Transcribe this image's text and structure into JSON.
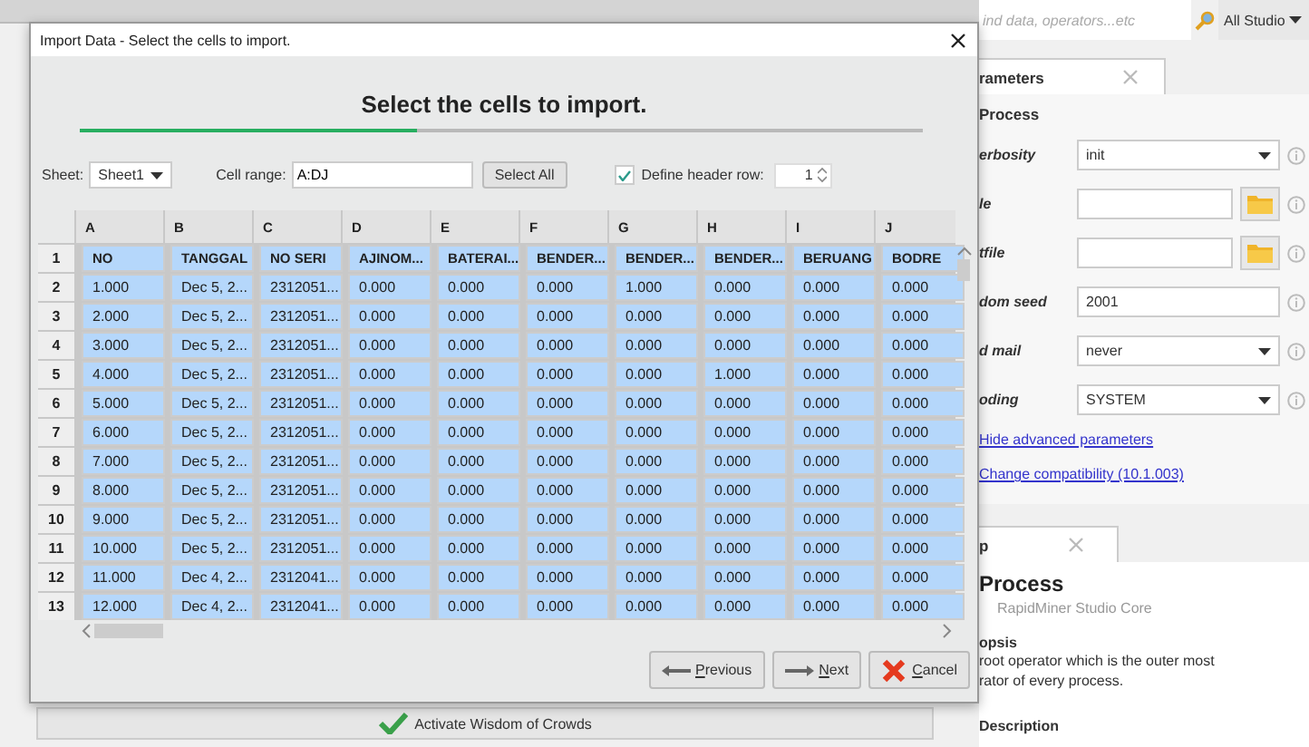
{
  "dialog": {
    "title": "Import Data - Select the cells to import.",
    "heading": "Select the cells to import.",
    "progress": {
      "level": 0.4
    },
    "sheet": {
      "label": "Sheet:",
      "value": "Sheet1"
    },
    "cell_range": {
      "label": "Cell range:",
      "value": "A:DJ"
    },
    "select_all": "Select All",
    "header_row": {
      "label": "Define header row:",
      "checked": true,
      "value": "1"
    },
    "table": {
      "columns": [
        "A",
        "B",
        "C",
        "D",
        "E",
        "F",
        "G",
        "H",
        "I",
        "J"
      ],
      "rows": [
        {
          "number": "1",
          "selected": true,
          "cells": [
            "NO",
            "TANGGAL",
            "NO SERI",
            "AJINOM...",
            "BATERAI...",
            "BENDER...",
            "BENDER...",
            "BENDER...",
            "BERUANG",
            "BODRE"
          ]
        },
        {
          "number": "2",
          "selected": true,
          "cells": [
            "1.000",
            "Dec 5, 2...",
            "2312051...",
            "0.000",
            "0.000",
            "0.000",
            "1.000",
            "0.000",
            "0.000",
            "0.000"
          ]
        },
        {
          "number": "3",
          "selected": true,
          "cells": [
            "2.000",
            "Dec 5, 2...",
            "2312051...",
            "0.000",
            "0.000",
            "0.000",
            "0.000",
            "0.000",
            "0.000",
            "0.000"
          ]
        },
        {
          "number": "4",
          "selected": true,
          "cells": [
            "3.000",
            "Dec 5, 2...",
            "2312051...",
            "0.000",
            "0.000",
            "0.000",
            "0.000",
            "0.000",
            "0.000",
            "0.000"
          ]
        },
        {
          "number": "5",
          "selected": true,
          "cells": [
            "4.000",
            "Dec 5, 2...",
            "2312051...",
            "0.000",
            "0.000",
            "0.000",
            "0.000",
            "1.000",
            "0.000",
            "0.000"
          ]
        },
        {
          "number": "6",
          "selected": true,
          "cells": [
            "5.000",
            "Dec 5, 2...",
            "2312051...",
            "0.000",
            "0.000",
            "0.000",
            "0.000",
            "0.000",
            "0.000",
            "0.000"
          ]
        },
        {
          "number": "7",
          "selected": true,
          "cells": [
            "6.000",
            "Dec 5, 2...",
            "2312051...",
            "0.000",
            "0.000",
            "0.000",
            "0.000",
            "0.000",
            "0.000",
            "0.000"
          ]
        },
        {
          "number": "8",
          "selected": true,
          "cells": [
            "7.000",
            "Dec 5, 2...",
            "2312051...",
            "0.000",
            "0.000",
            "0.000",
            "0.000",
            "0.000",
            "0.000",
            "0.000"
          ]
        },
        {
          "number": "9",
          "selected": true,
          "cells": [
            "8.000",
            "Dec 5, 2...",
            "2312051...",
            "0.000",
            "0.000",
            "0.000",
            "0.000",
            "0.000",
            "0.000",
            "0.000"
          ]
        },
        {
          "number": "10",
          "selected": true,
          "cells": [
            "9.000",
            "Dec 5, 2...",
            "2312051...",
            "0.000",
            "0.000",
            "0.000",
            "0.000",
            "0.000",
            "0.000",
            "0.000"
          ]
        },
        {
          "number": "11",
          "selected": true,
          "cells": [
            "10.000",
            "Dec 5, 2...",
            "2312051...",
            "0.000",
            "0.000",
            "0.000",
            "0.000",
            "0.000",
            "0.000",
            "0.000"
          ]
        },
        {
          "number": "12",
          "selected": true,
          "cells": [
            "11.000",
            "Dec 4, 2...",
            "2312041...",
            "0.000",
            "0.000",
            "0.000",
            "0.000",
            "0.000",
            "0.000",
            "0.000"
          ]
        },
        {
          "number": "13",
          "selected": true,
          "cells": [
            "12.000",
            "Dec 4, 2...",
            "2312041...",
            "0.000",
            "0.000",
            "0.000",
            "0.000",
            "0.000",
            "0.000",
            "0.000"
          ]
        }
      ]
    },
    "buttons": [
      {
        "kind": "previous",
        "label": "Previous"
      },
      {
        "kind": "next",
        "label": "Next"
      },
      {
        "kind": "cancel",
        "label": "Cancel"
      }
    ]
  },
  "wisdom_button": "Activate Wisdom of Crowds",
  "search": {
    "placeholder": "ind data, operators...etc"
  },
  "scope": "All Studio",
  "parameters": {
    "tab": "rameters",
    "title": "Process",
    "rows": [
      {
        "kind": "combo",
        "label": "erbosity",
        "value": "init"
      },
      {
        "kind": "file",
        "label": "le"
      },
      {
        "kind": "file",
        "label": "tfile"
      },
      {
        "kind": "text",
        "label": "dom seed",
        "value": "2001"
      },
      {
        "kind": "combo",
        "label": "d mail",
        "value": "never"
      },
      {
        "kind": "combo",
        "label": "oding",
        "value": "SYSTEM"
      }
    ],
    "links": [
      "Hide advanced parameters",
      "Change compatibility (10.1.003)"
    ]
  },
  "help": {
    "tab": "p",
    "title": "Process",
    "subtitle": "RapidMiner Studio Core",
    "section": "opsis",
    "lines": [
      "root operator which is the outer most",
      "rator of every process."
    ],
    "next_section": "Description"
  }
}
